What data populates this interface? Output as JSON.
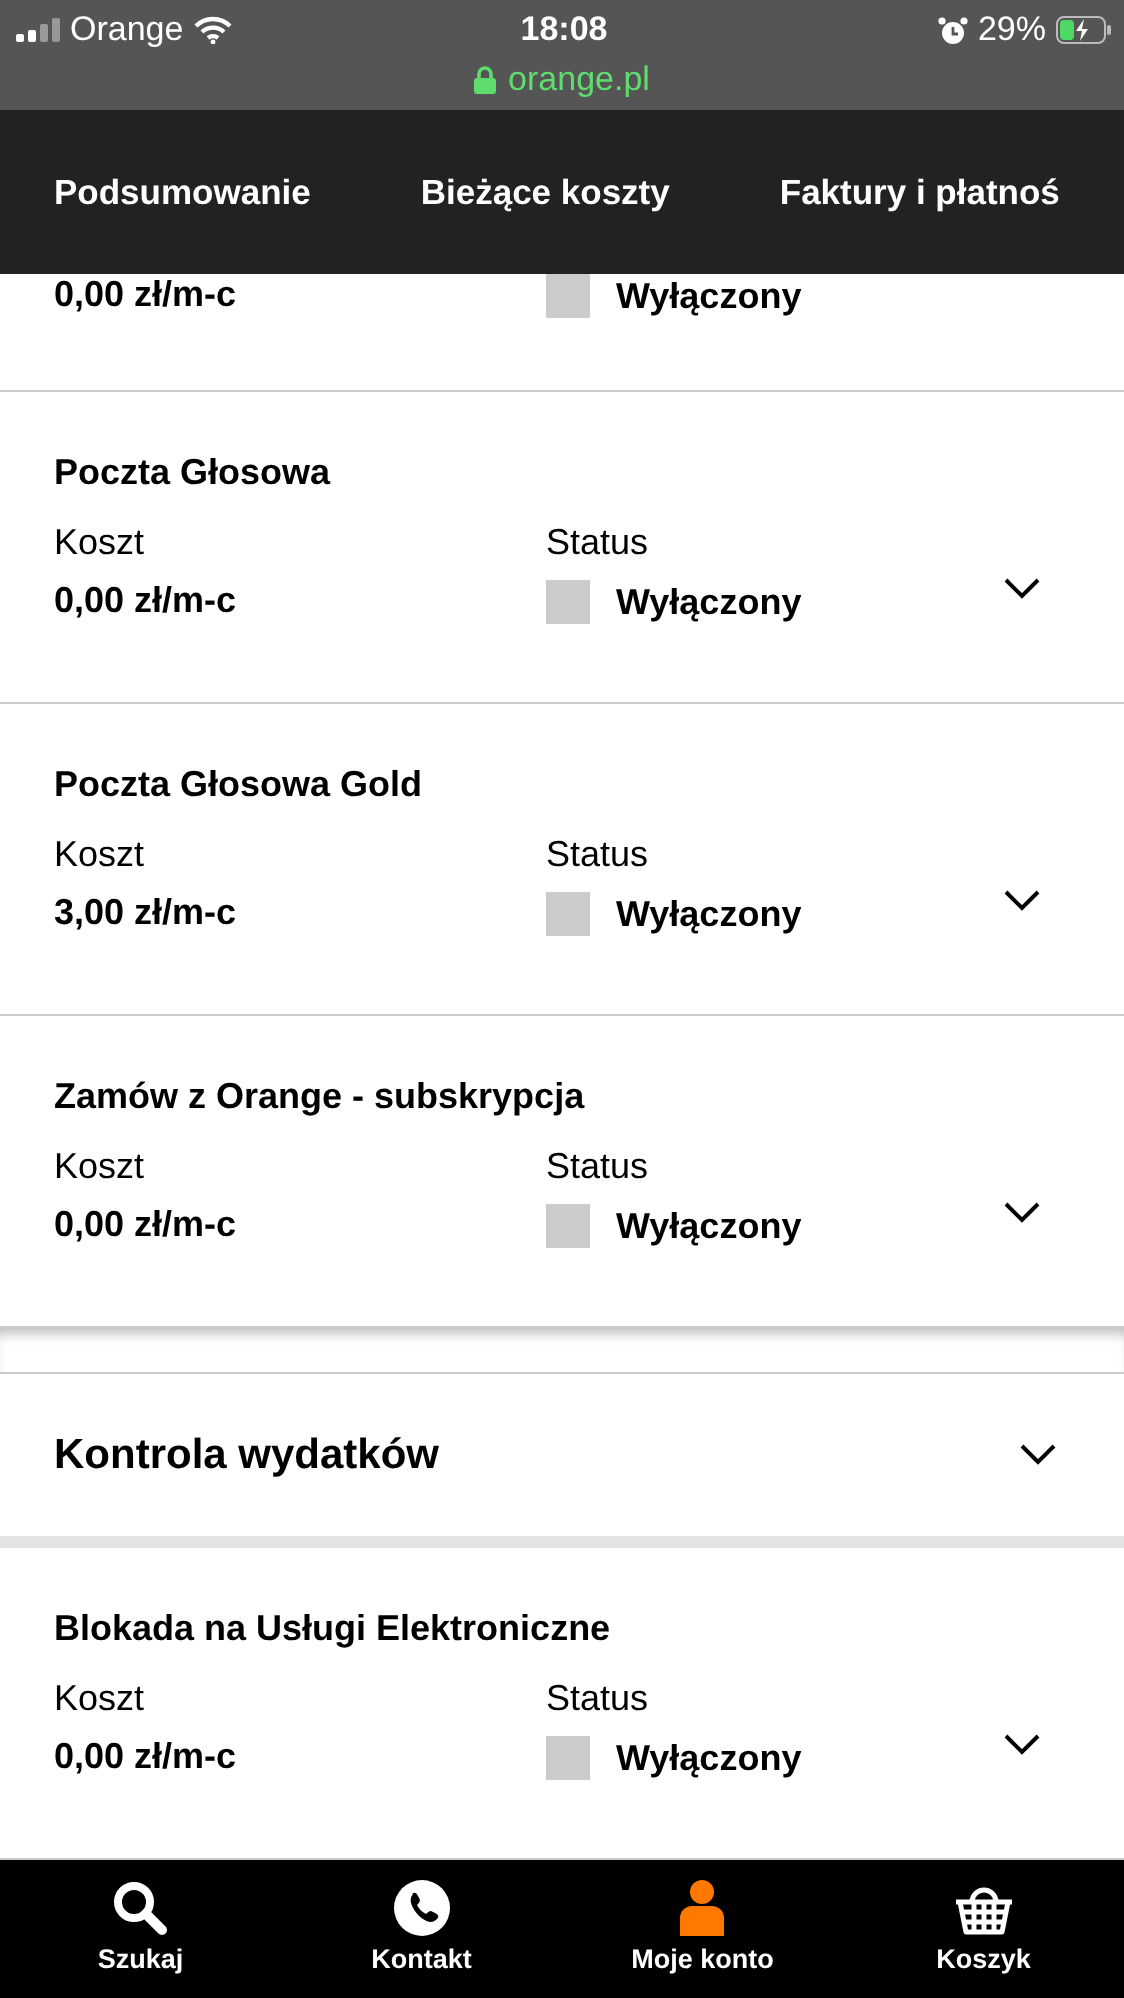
{
  "status_bar": {
    "carrier": "Orange",
    "time": "18:08",
    "battery": "29%",
    "url": "orange.pl"
  },
  "tabs": [
    {
      "label": "Podsumowanie"
    },
    {
      "label": "Bieżące koszty"
    },
    {
      "label": "Faktury i płatnoś"
    }
  ],
  "partial_service": {
    "cost": "0,00 zł/m-c",
    "status": "Wyłączony",
    "enabled": false
  },
  "services": [
    {
      "name": "Poczta Głosowa",
      "cost_label": "Koszt",
      "cost": "0,00 zł/m-c",
      "status_label": "Status",
      "status": "Wyłączony",
      "enabled": false
    },
    {
      "name": "Poczta Głosowa Gold",
      "cost_label": "Koszt",
      "cost": "3,00 zł/m-c",
      "status_label": "Status",
      "status": "Wyłączony",
      "enabled": false
    },
    {
      "name": "Zamów z Orange - subskrypcja",
      "cost_label": "Koszt",
      "cost": "0,00 zł/m-c",
      "status_label": "Status",
      "status": "Wyłączony",
      "enabled": false
    }
  ],
  "section": {
    "title": "Kontrola wydatków",
    "expanded": false
  },
  "section_services": [
    {
      "name": "Blokada na Usługi Elektroniczne",
      "cost_label": "Koszt",
      "cost": "0,00 zł/m-c",
      "status_label": "Status",
      "status": "Wyłączony",
      "enabled": false
    }
  ],
  "bottom_nav": [
    {
      "label": "Szukaj",
      "kind": "search",
      "selected": false
    },
    {
      "label": "Kontakt",
      "kind": "phone",
      "selected": false
    },
    {
      "label": "Moje konto",
      "kind": "person",
      "selected": true
    },
    {
      "label": "Koszyk",
      "kind": "basket",
      "selected": false
    }
  ]
}
